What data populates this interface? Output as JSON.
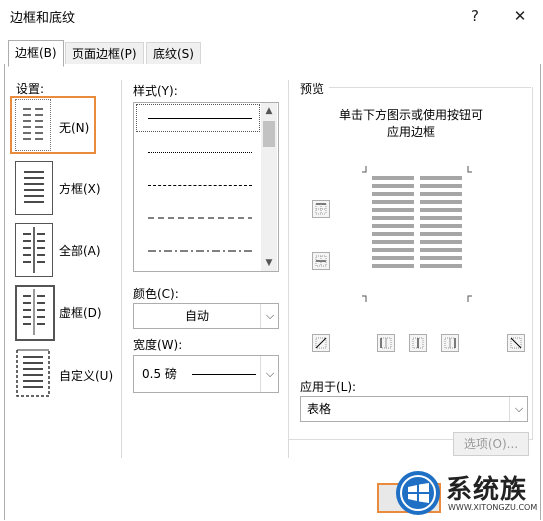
{
  "window": {
    "title": "边框和底纹",
    "help": "?",
    "close": "✕"
  },
  "tabs": [
    {
      "label": "边框(B)"
    },
    {
      "label": "页面边框(P)"
    },
    {
      "label": "底纹(S)"
    }
  ],
  "settings": {
    "heading": "设置:",
    "items": [
      {
        "label": "无(N)"
      },
      {
        "label": "方框(X)"
      },
      {
        "label": "全部(A)"
      },
      {
        "label": "虚框(D)"
      },
      {
        "label": "自定义(U)"
      }
    ]
  },
  "style": {
    "label": "样式(Y):"
  },
  "color": {
    "label": "颜色(C):",
    "value": "自动"
  },
  "width": {
    "label": "宽度(W):",
    "value": "0.5 磅"
  },
  "preview": {
    "heading": "预览",
    "hint_line1": "单击下方图示或使用按钮可",
    "hint_line2": "应用边框"
  },
  "apply_to": {
    "label": "应用于(L):",
    "value": "表格"
  },
  "options_button": {
    "label": "选项(O)..."
  },
  "watermark": {
    "brand": "系统族",
    "url": "WWW.XITONGZU.COM"
  },
  "colors": {
    "selection": "#ea8a3c",
    "border": "#adadad"
  }
}
